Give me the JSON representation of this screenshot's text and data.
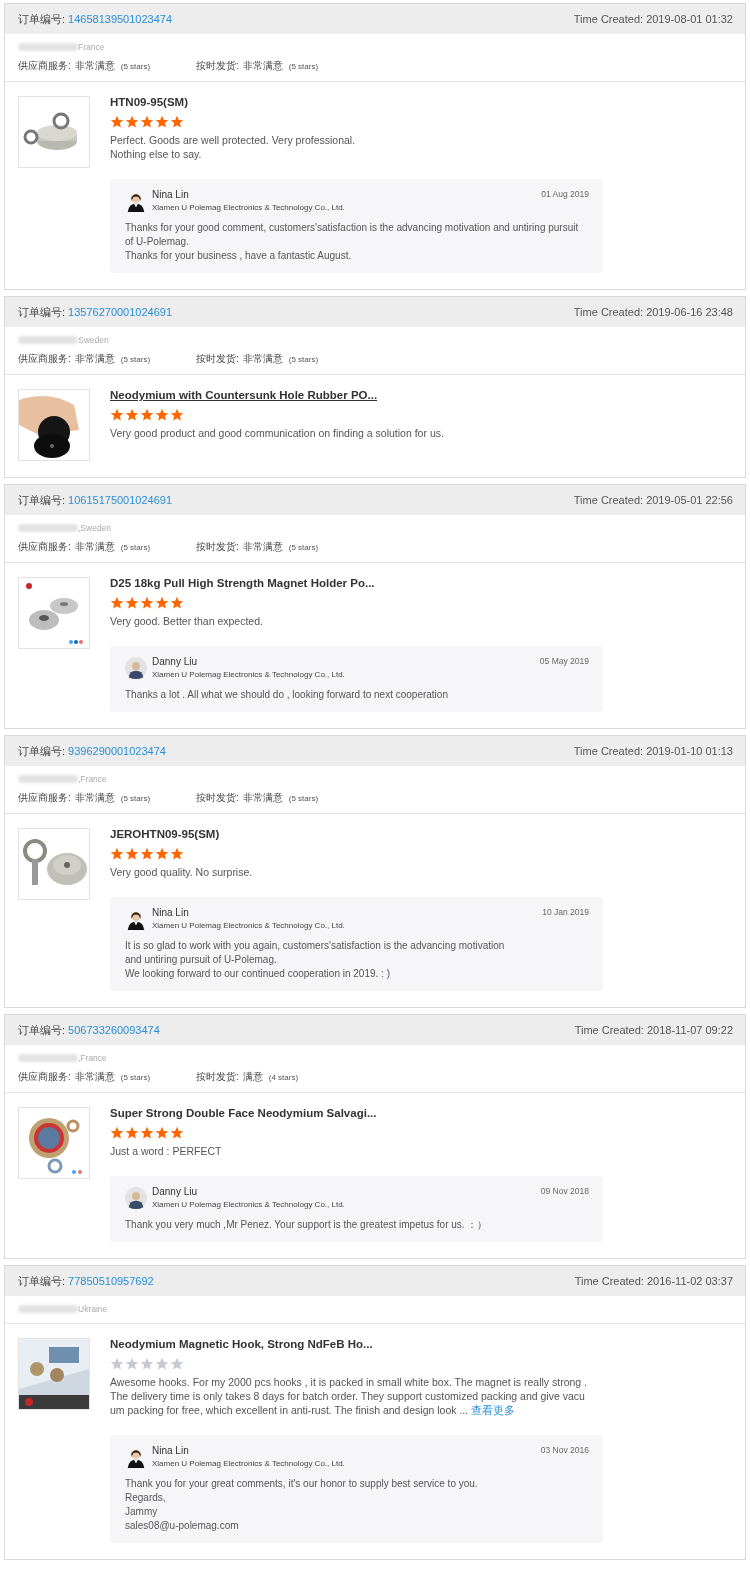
{
  "orders": [
    {
      "order_label": "订单编号:",
      "order_number": "14658139501023474",
      "time_created": "Time Created: 2019-08-01 01:32",
      "country": "France",
      "ratings": [
        {
          "label": "供应商服务:",
          "value": "非常满意",
          "stars_text": "(5 stars)"
        },
        {
          "label": "按时发货:",
          "value": "非常满意",
          "stars_text": "(5 stars)"
        }
      ],
      "product": {
        "title": "HTN09-95(SM)",
        "hovered": false
      },
      "stars": 5,
      "review": [
        "Perfect. Goods are well protected. Very professional.",
        "Nothing else to say."
      ],
      "reply": {
        "name": "Nina Lin",
        "company": "Xiamen U Polemag Electronics & Technology Co., Ltd.",
        "date": "01 Aug 2019",
        "lines": [
          "Thanks for your good comment, customers'satisfaction is the advancing motivation and untiring pursuit of U-Polemag.",
          "Thanks for your business , have a fantastic August."
        ]
      }
    },
    {
      "order_label": "订单编号:",
      "order_number": "13576270001024691",
      "time_created": "Time Created: 2019-06-16 23:48",
      "country": "Sweden",
      "ratings": [
        {
          "label": "供应商服务:",
          "value": "非常满意",
          "stars_text": "(5 stars)"
        },
        {
          "label": "按时发货:",
          "value": "非常满意",
          "stars_text": "(5 stars)"
        }
      ],
      "product": {
        "title": "Neodymium with Countersunk Hole Rubber PO...",
        "hovered": true
      },
      "stars": 5,
      "review": [
        "Very good product and good communication on finding a solution for us."
      ]
    },
    {
      "order_label": "订单编号:",
      "order_number": "10615175001024691",
      "time_created": "Time Created: 2019-05-01 22:56",
      "country": ",Sweden",
      "ratings": [
        {
          "label": "供应商服务:",
          "value": "非常满意",
          "stars_text": "(5 stars)"
        },
        {
          "label": "按时发货:",
          "value": "非常满意",
          "stars_text": "(5 stars)"
        }
      ],
      "product": {
        "title": "D25 18kg Pull High Strength Magnet Holder Po...",
        "hovered": false
      },
      "stars": 5,
      "review": [
        "Very good. Better than expected."
      ],
      "reply": {
        "name": "Danny Liu",
        "company": "Xiamen U Polemag Electronics & Technology Co., Ltd.",
        "date": "05 May 2019",
        "lines": [
          "Thanks a lot . All what we should do , looking forward to next cooperation"
        ]
      }
    },
    {
      "order_label": "订单编号:",
      "order_number": "9396290001023474",
      "time_created": "Time Created: 2019-01-10 01:13",
      "country": ",France",
      "ratings": [
        {
          "label": "供应商服务:",
          "value": "非常满意",
          "stars_text": "(5 stars)"
        },
        {
          "label": "按时发货:",
          "value": "非常满意",
          "stars_text": "(5 stars)"
        }
      ],
      "product": {
        "title": "JEROHTN09-95(SM)",
        "hovered": false
      },
      "stars": 5,
      "review": [
        "Very good quality. No surprise."
      ],
      "reply": {
        "name": "Nina Lin",
        "company": "Xiamen U Polemag Electronics & Technology Co., Ltd.",
        "date": "10 Jan 2019",
        "lines": [
          "It is so glad to work with you again, customers'satisfaction is the advancing motivation",
          "and untiring pursuit of U-Polemag.",
          "We looking forward to our continued cooperation in 2019. : )"
        ]
      }
    },
    {
      "order_label": "订单编号:",
      "order_number": "506733260093474",
      "time_created": "Time Created: 2018-11-07 09:22",
      "country": ",France",
      "ratings": [
        {
          "label": "供应商服务:",
          "value": "非常满意",
          "stars_text": "(5 stars)"
        },
        {
          "label": "按时发货:",
          "value": "满意",
          "stars_text": "(4 stars)"
        }
      ],
      "product": {
        "title": "Super Strong Double Face Neodymium Salvagi...",
        "hovered": false
      },
      "stars": 5,
      "review": [
        "Just a word : PERFECT"
      ],
      "reply": {
        "name": "Danny Liu",
        "company": "Xiamen U Polemag Electronics & Technology Co., Ltd.",
        "date": "09 Nov 2018",
        "lines": [
          "Thank you very much ,Mr Penez.  Your support is the greatest impetus for us. ：）"
        ]
      }
    },
    {
      "order_label": "订单编号:",
      "order_number": "77850510957692",
      "time_created": "Time Created: 2016-11-02 03:37",
      "country": "Ukraine",
      "product": {
        "title": "Neodymium Magnetic Hook, Strong NdFeB Ho...",
        "hovered": false
      },
      "stars": 0,
      "review": [
        "Awesome hooks. For my 2000 pcs hooks , it is packed in small white box. The magnet is really strong .The delivery time is only takes 8 days for batch order. They support customized packing and give vacuum packing for free, which excellent in anti-rust. The finish and design look ..."
      ],
      "more_link": "查看更多",
      "reply": {
        "name": "Nina Lin",
        "company": "Xiamen U Polemag Electronics & Technology Co., Ltd.",
        "date": "03 Nov 2016",
        "lines": [
          "Thank you for your great comments, it's our honor to supply best service to you.",
          "Regards,",
          "Jammy",
          "sales08@u-polemag.com"
        ]
      }
    }
  ]
}
